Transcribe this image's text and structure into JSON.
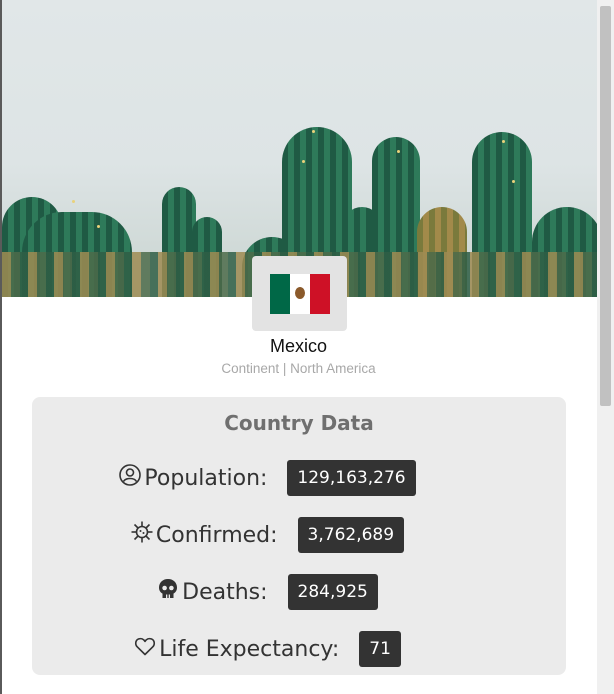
{
  "country": {
    "name": "Mexico",
    "continent_text": "Continent | North America",
    "flag_colors": [
      "#006847",
      "#ffffff",
      "#ce1126"
    ]
  },
  "panel": {
    "title": "Country Data",
    "rows": [
      {
        "label": "Population:",
        "value": "129,163,276",
        "icon": "person-circle-icon"
      },
      {
        "label": "Confirmed:",
        "value": "3,762,689",
        "icon": "virus-icon"
      },
      {
        "label": "Deaths:",
        "value": "284,925",
        "icon": "skull-icon"
      },
      {
        "label": "Life Expectancy:",
        "value": "71",
        "icon": "heart-icon"
      }
    ]
  },
  "colors": {
    "badge_bg": "#333333",
    "panel_bg": "#ebebeb",
    "title_color": "#6f6f6f"
  }
}
